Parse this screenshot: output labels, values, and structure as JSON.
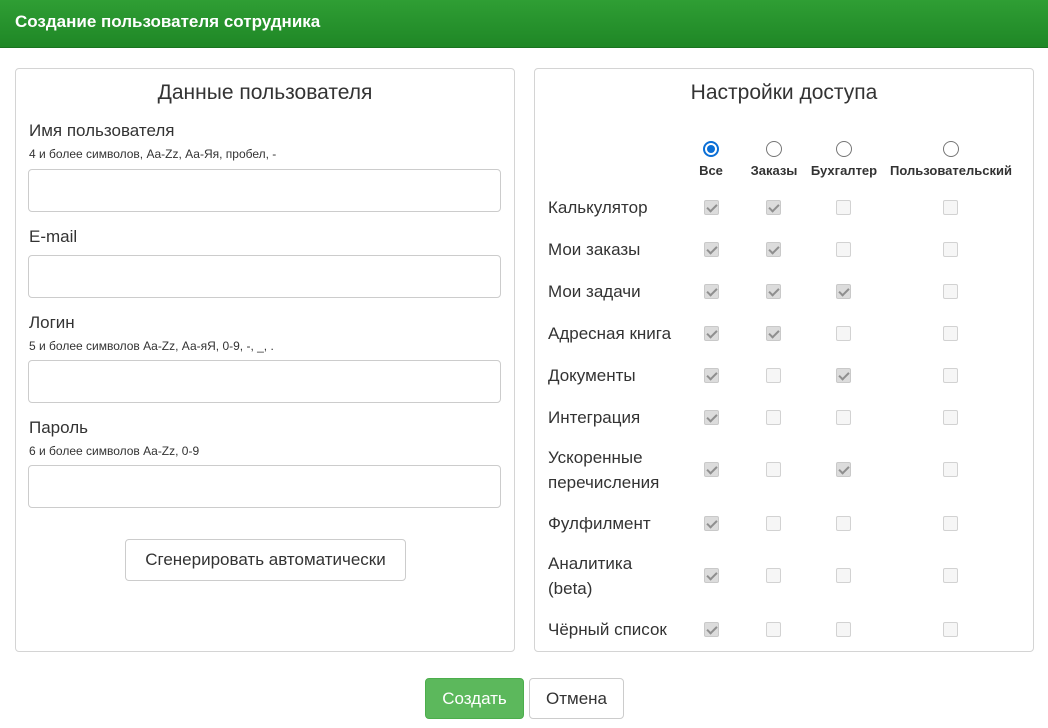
{
  "header": {
    "title": "Создание пользователя сотрудника"
  },
  "user_panel": {
    "title": "Данные пользователя",
    "fields": [
      {
        "label": "Имя пользователя",
        "hint": "4 и более символов, Aa-Zz, Аа-Яя, пробел, -",
        "value": ""
      },
      {
        "label": "E-mail",
        "hint": "",
        "value": ""
      },
      {
        "label": "Логин",
        "hint": "5 и более символов Aa-Zz, Аа-яЯ, 0-9, -, _, .",
        "value": ""
      },
      {
        "label": "Пароль",
        "hint": "6 и более символов Aa-Zz, 0-9",
        "value": ""
      }
    ],
    "generate_label": "Сгенерировать автоматически"
  },
  "access_panel": {
    "title": "Настройки доступа",
    "roles": [
      {
        "label": "Все",
        "selected": true
      },
      {
        "label": "Заказы",
        "selected": false
      },
      {
        "label": "Бухгалтер",
        "selected": false
      },
      {
        "label": "Пользовательский",
        "selected": false
      }
    ],
    "permissions": [
      {
        "label": "Калькулятор",
        "checks": [
          true,
          true,
          false,
          false
        ]
      },
      {
        "label": "Мои заказы",
        "checks": [
          true,
          true,
          false,
          false
        ]
      },
      {
        "label": "Мои задачи",
        "checks": [
          true,
          true,
          true,
          false
        ]
      },
      {
        "label": "Адресная книга",
        "checks": [
          true,
          true,
          false,
          false
        ]
      },
      {
        "label": "Документы",
        "checks": [
          true,
          false,
          true,
          false
        ]
      },
      {
        "label": "Интеграция",
        "checks": [
          true,
          false,
          false,
          false
        ]
      },
      {
        "label": "Ускоренные перечисления",
        "checks": [
          true,
          false,
          true,
          false
        ]
      },
      {
        "label": "Фулфилмент",
        "checks": [
          true,
          false,
          false,
          false
        ]
      },
      {
        "label": "Аналитика (beta)",
        "checks": [
          true,
          false,
          false,
          false
        ]
      },
      {
        "label": "Чёрный список",
        "checks": [
          true,
          false,
          false,
          false
        ]
      }
    ]
  },
  "actions": {
    "create_label": "Создать",
    "cancel_label": "Отмена"
  },
  "colors": {
    "header": "#1f8726",
    "create_button": "#5cb85c",
    "radio_selected": "#0b6fd6"
  }
}
